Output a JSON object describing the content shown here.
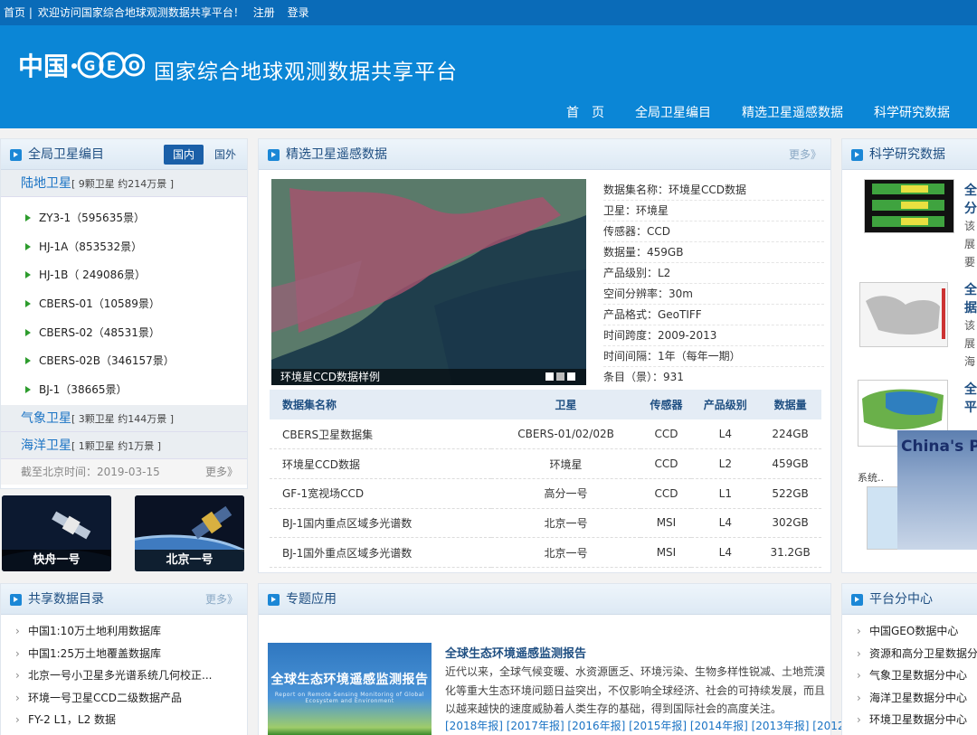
{
  "topbar": {
    "home": "首页",
    "welcome": "欢迎访问国家综合地球观测数据共享平台！",
    "register": "注册",
    "login": "登录",
    "separator": "|"
  },
  "header": {
    "site_name": "国家综合地球观测数据共享平台",
    "logo_text": "中国·GEO"
  },
  "nav": [
    "首　页",
    "全局卫星编目",
    "精选卫星遥感数据",
    "科学研究数据"
  ],
  "catalog": {
    "title": "全局卫星编目",
    "tab_domestic": "国内",
    "tab_foreign": "国外",
    "land": {
      "name": "陆地卫星",
      "info": "[ 9颗卫星 约214万景 ]"
    },
    "satellites": [
      "ZY3-1（595635景）",
      "HJ-1A（853532景）",
      "HJ-1B（ 249086景）",
      "CBERS-01（10589景）",
      "CBERS-02（48531景）",
      "CBERS-02B（346157景）",
      "BJ-1（38665景）"
    ],
    "meteo": {
      "name": "气象卫星",
      "info": "[ 3颗卫星 约144万景 ]"
    },
    "ocean": {
      "name": "海洋卫星",
      "info": "[ 1颗卫星 约1万景 ]"
    },
    "date": "截至北京时间：2019-03-15",
    "more": "更多》"
  },
  "sat_images": [
    {
      "label": "快舟一号"
    },
    {
      "label": "北京一号"
    }
  ],
  "featured": {
    "title": "精选卫星遥感数据",
    "more": "更多》",
    "caption": "环境星CCD数据样例",
    "meta": [
      "数据集名称：环境星CCD数据",
      "卫星：环境星",
      "传感器：CCD",
      "数据量：459GB",
      "产品级别：L2",
      "空间分辨率：30m",
      "产品格式：GeoTIFF",
      "时间跨度：2009-2013",
      "时间间隔：1年（每年一期）",
      "条目（景）：931"
    ],
    "table": {
      "headers": [
        "数据集名称",
        "卫星",
        "传感器",
        "产品级别",
        "数据量"
      ],
      "rows": [
        [
          "CBERS卫星数据集",
          "CBERS-01/02/02B",
          "CCD",
          "L4",
          "224GB"
        ],
        [
          "环境星CCD数据",
          "环境星",
          "CCD",
          "L2",
          "459GB"
        ],
        [
          "GF-1宽视场CCD",
          "高分一号",
          "CCD",
          "L1",
          "522GB"
        ],
        [
          "BJ-1国内重点区域多光谱数",
          "北京一号",
          "MSI",
          "L4",
          "302GB"
        ],
        [
          "BJ-1国外重点区域多光谱数",
          "北京一号",
          "MSI",
          "L4",
          "31.2GB"
        ]
      ]
    }
  },
  "research": {
    "title": "科学研究数据",
    "items": [
      {
        "t1": "全",
        "t2": "分",
        "d": [
          "该",
          "展",
          "要"
        ]
      },
      {
        "t1": "全",
        "t2": "据",
        "d": [
          "该",
          "展",
          "海"
        ]
      },
      {
        "t1": "全",
        "t2": "平",
        "d": []
      }
    ],
    "sys_text": "系统..",
    "poster_text": "China's Plan"
  },
  "share": {
    "title": "共享数据目录",
    "more": "更多》",
    "items": [
      "中国1:10万土地利用数据库",
      "中国1:25万土地覆盖数据库",
      "北京一号小卫星多光谱系统几何校正...",
      "环境一号卫星CCD二级数据产品",
      "FY-2 L1，L2 数据"
    ]
  },
  "topic": {
    "title": "专题应用",
    "banner": "全球生态环境遥感监测报告",
    "banner_sub": "Report on Remote Sensing Monitoring of Global Ecosystem and Environment",
    "report_title": "全球生态环境遥感监测报告",
    "report_text": "近代以来，全球气候变暖、水资源匮乏、环境污染、生物多样性锐减、土地荒漠化等重大生态环境问题日益突出，不仅影响全球经济、社会的可持续发展，而且以越来越快的速度威胁着人类生存的基础，得到国际社会的高度关注。",
    "years": "[2018年报] [2017年报] [2016年报] [2015年报] [2014年报] [2013年报] [2012"
  },
  "subcenter": {
    "title": "平台分中心",
    "items": [
      "中国GEO数据中心",
      "资源和高分卫星数据分",
      "气象卫星数据分中心",
      "海洋卫星数据分中心",
      "环境卫星数据分中心"
    ]
  }
}
